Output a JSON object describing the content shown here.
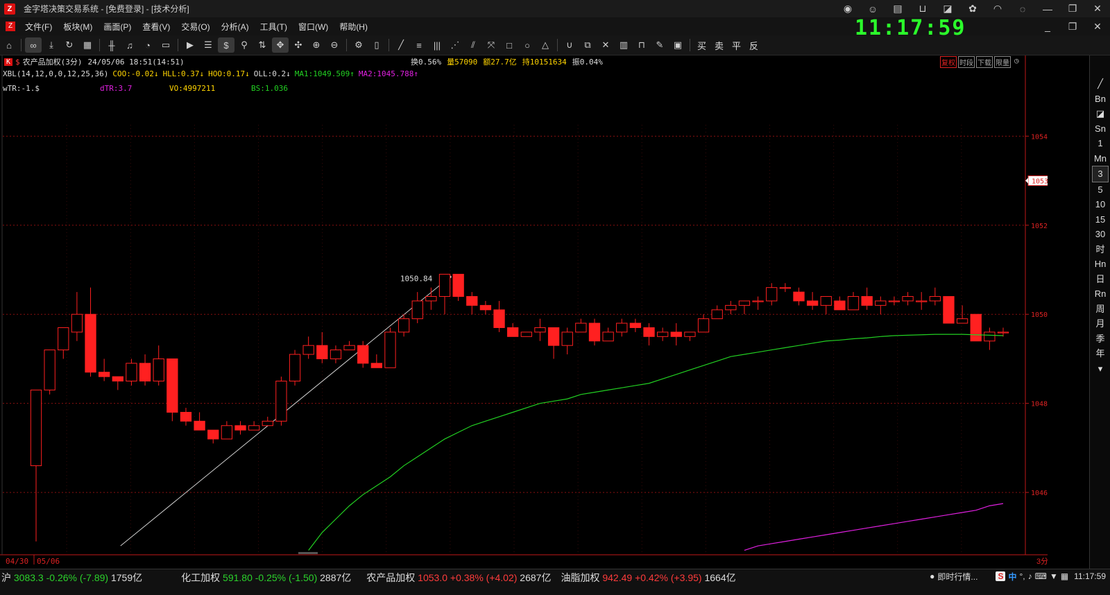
{
  "window": {
    "title": "金字塔决策交易系统 - [免费登录] - [技术分析]"
  },
  "menu": [
    "文件(F)",
    "板块(M)",
    "画面(P)",
    "查看(V)",
    "交易(O)",
    "分析(A)",
    "工具(T)",
    "窗口(W)",
    "帮助(H)"
  ],
  "clock": "11:17:59",
  "toolbar": {
    "right_labels": [
      "买",
      "卖",
      "平",
      "反"
    ],
    "dollar": "$"
  },
  "info": {
    "badge": "K",
    "instrument": "农产品加权(3分)",
    "datetime": "24/05/06 18:51(14:51)",
    "huan": "换0.56%",
    "liang": "量57090",
    "e": "额27.7亿",
    "chi": "持10151634",
    "zhen": "振0.04%",
    "buttons": [
      "复权",
      "时段",
      "下载",
      "限量"
    ]
  },
  "indicator1": {
    "name": "XBL(14,12,0,0,12,25,36)",
    "coo": "COO:-0.02↓",
    "hll": "HLL:0.37↓",
    "hoo": "HOO:0.17↓",
    "oll": "OLL:0.2↓",
    "ma1": "MA1:1049.509↑",
    "ma2": "MA2:1045.788↑"
  },
  "indicator2": {
    "wtr": "wTR:-1.$",
    "dtr": "dTR:3.7",
    "vo": "VO:4997211",
    "bs": "BS:1.036"
  },
  "colors": {
    "up": "#ff2020",
    "ma1": "#22d022",
    "ma2": "#e020e0",
    "grid": "#8a1010",
    "axis": "#c01818",
    "hollow": "#ff2020"
  },
  "periods": [
    "Bn",
    "Sn",
    "1",
    "Mn",
    "3",
    "5",
    "10",
    "15",
    "30",
    "时",
    "Hn",
    "日",
    "Rn",
    "周",
    "月",
    "季",
    "年"
  ],
  "selected_period": "3",
  "chart_data": {
    "type": "candlestick",
    "y_ticks": [
      "1054.00",
      "1052.00",
      "1050.00",
      "1048.00",
      "1046.00"
    ],
    "ylim": [
      1044.6,
      1055.5
    ],
    "current_price": "1053.00",
    "current_value": 1053.0,
    "annotation": "1050.84",
    "x_labels": [
      "04/30",
      "05/06"
    ],
    "period_label": "3分",
    "candles": [
      [
        1046.6,
        1048.3,
        1044.9,
        1048.3
      ],
      [
        1048.3,
        1049.2,
        1048.2,
        1049.2
      ],
      [
        1049.2,
        1049.7,
        1049.0,
        1049.6
      ],
      [
        1049.6,
        1050.0,
        1049.4,
        1050.5
      ],
      [
        1050.0,
        1048.7,
        1048.6,
        1050.6
      ],
      [
        1048.7,
        1048.6,
        1048.5,
        1049.0
      ],
      [
        1048.6,
        1048.5,
        1048.3,
        1048.6
      ],
      [
        1048.5,
        1048.9,
        1048.4,
        1049.0
      ],
      [
        1048.9,
        1048.5,
        1048.4,
        1049.1
      ],
      [
        1048.5,
        1049.0,
        1048.4,
        1049.3
      ],
      [
        1049.0,
        1047.8,
        1047.6,
        1049.0
      ],
      [
        1047.8,
        1047.6,
        1047.5,
        1047.9
      ],
      [
        1047.6,
        1047.4,
        1047.4,
        1047.8
      ],
      [
        1047.4,
        1047.2,
        1047.1,
        1047.4
      ],
      [
        1047.2,
        1047.5,
        1047.2,
        1047.6
      ],
      [
        1047.5,
        1047.4,
        1047.3,
        1047.6
      ],
      [
        1047.4,
        1047.5,
        1047.4,
        1047.6
      ],
      [
        1047.5,
        1047.6,
        1047.5,
        1047.7
      ],
      [
        1047.6,
        1048.5,
        1047.5,
        1048.6
      ],
      [
        1048.5,
        1049.1,
        1048.4,
        1049.2
      ],
      [
        1049.1,
        1049.3,
        1049.0,
        1049.5
      ],
      [
        1049.3,
        1049.0,
        1048.9,
        1049.6
      ],
      [
        1049.0,
        1049.2,
        1048.9,
        1049.3
      ],
      [
        1049.2,
        1049.3,
        1049.2,
        1049.4
      ],
      [
        1049.3,
        1048.9,
        1048.8,
        1049.4
      ],
      [
        1048.9,
        1048.8,
        1048.8,
        1049.1
      ],
      [
        1048.8,
        1049.6,
        1048.8,
        1049.7
      ],
      [
        1049.6,
        1049.9,
        1049.5,
        1050.0
      ],
      [
        1049.9,
        1050.3,
        1049.8,
        1050.5
      ],
      [
        1050.3,
        1050.4,
        1050.1,
        1050.6
      ],
      [
        1050.4,
        1050.9,
        1050.0,
        1050.9
      ],
      [
        1050.9,
        1050.4,
        1050.3,
        1050.9
      ],
      [
        1050.4,
        1050.2,
        1050.0,
        1050.5
      ],
      [
        1050.2,
        1050.1,
        1050.0,
        1050.3
      ],
      [
        1050.1,
        1049.7,
        1049.6,
        1050.3
      ],
      [
        1049.7,
        1049.5,
        1049.5,
        1049.8
      ],
      [
        1049.5,
        1049.6,
        1049.5,
        1049.6
      ],
      [
        1049.6,
        1049.7,
        1049.4,
        1049.9
      ],
      [
        1049.7,
        1049.3,
        1049.0,
        1049.7
      ],
      [
        1049.3,
        1049.6,
        1049.1,
        1049.7
      ],
      [
        1049.6,
        1049.8,
        1049.6,
        1049.9
      ],
      [
        1049.8,
        1049.4,
        1049.3,
        1049.9
      ],
      [
        1049.4,
        1049.6,
        1049.4,
        1049.7
      ],
      [
        1049.6,
        1049.8,
        1049.5,
        1049.9
      ],
      [
        1049.8,
        1049.7,
        1049.6,
        1049.9
      ],
      [
        1049.7,
        1049.5,
        1049.3,
        1049.8
      ],
      [
        1049.5,
        1049.6,
        1049.4,
        1049.7
      ],
      [
        1049.6,
        1049.5,
        1049.3,
        1049.8
      ],
      [
        1049.5,
        1049.6,
        1049.4,
        1049.6
      ],
      [
        1049.6,
        1049.9,
        1049.6,
        1050.0
      ],
      [
        1049.9,
        1050.1,
        1049.9,
        1050.2
      ],
      [
        1050.1,
        1050.2,
        1050.0,
        1050.3
      ],
      [
        1050.2,
        1050.3,
        1050.0,
        1050.3
      ],
      [
        1050.3,
        1050.3,
        1050.1,
        1050.4
      ],
      [
        1050.3,
        1050.6,
        1050.2,
        1050.7
      ],
      [
        1050.6,
        1050.6,
        1050.5,
        1050.7
      ],
      [
        1050.5,
        1050.3,
        1050.2,
        1050.6
      ],
      [
        1050.3,
        1050.2,
        1050.1,
        1050.5
      ],
      [
        1050.2,
        1050.4,
        1050.0,
        1050.4
      ],
      [
        1050.3,
        1050.1,
        1050.1,
        1050.4
      ],
      [
        1050.1,
        1050.4,
        1050.1,
        1050.5
      ],
      [
        1050.4,
        1050.2,
        1050.1,
        1050.6
      ],
      [
        1050.2,
        1050.3,
        1050.0,
        1050.4
      ],
      [
        1050.3,
        1050.3,
        1050.2,
        1050.4
      ],
      [
        1050.3,
        1050.4,
        1050.2,
        1050.5
      ],
      [
        1050.3,
        1050.3,
        1050.1,
        1050.5
      ],
      [
        1050.3,
        1050.4,
        1050.2,
        1050.6
      ],
      [
        1050.4,
        1049.8,
        1049.8,
        1050.4
      ],
      [
        1049.8,
        1049.9,
        1049.8,
        1050.2
      ],
      [
        1050.0,
        1049.4,
        1049.4,
        1050.0
      ],
      [
        1049.4,
        1049.6,
        1049.2,
        1049.7
      ],
      [
        1049.6,
        1049.6,
        1049.5,
        1049.7
      ]
    ],
    "ma1": [
      null,
      null,
      null,
      null,
      null,
      null,
      null,
      null,
      null,
      null,
      null,
      null,
      null,
      null,
      null,
      null,
      null,
      null,
      null,
      null,
      1044.7,
      1045.1,
      1045.4,
      1045.7,
      1045.95,
      1046.15,
      1046.35,
      1046.6,
      1046.8,
      1047.0,
      1047.2,
      1047.35,
      1047.5,
      1047.6,
      1047.7,
      1047.8,
      1047.9,
      1048.0,
      1048.05,
      1048.1,
      1048.2,
      1048.25,
      1048.3,
      1048.35,
      1048.4,
      1048.45,
      1048.55,
      1048.65,
      1048.75,
      1048.85,
      1048.95,
      1049.05,
      1049.1,
      1049.15,
      1049.2,
      1049.25,
      1049.3,
      1049.35,
      1049.4,
      1049.42,
      1049.45,
      1049.47,
      1049.5,
      1049.52,
      1049.53,
      1049.54,
      1049.55,
      1049.55,
      1049.55,
      1049.54,
      1049.53,
      1049.52
    ],
    "ma2": [
      null,
      null,
      null,
      null,
      null,
      null,
      null,
      null,
      null,
      null,
      null,
      null,
      null,
      null,
      null,
      null,
      null,
      null,
      null,
      null,
      null,
      null,
      null,
      null,
      null,
      null,
      null,
      null,
      null,
      null,
      null,
      null,
      null,
      null,
      null,
      null,
      null,
      null,
      null,
      null,
      null,
      null,
      null,
      null,
      null,
      null,
      null,
      null,
      null,
      null,
      null,
      null,
      1044.7,
      1044.8,
      1044.85,
      1044.9,
      1044.95,
      1045.0,
      1045.05,
      1045.1,
      1045.15,
      1045.2,
      1045.25,
      1045.3,
      1045.35,
      1045.4,
      1045.45,
      1045.5,
      1045.55,
      1045.6,
      1045.7,
      1045.75
    ]
  },
  "status": [
    {
      "name": "沪",
      "value": "3083.3",
      "pct": "-0.26%",
      "chg": "(-7.89)",
      "amt": "1759亿",
      "dir": "down"
    },
    {
      "name": "化工加权",
      "value": "591.80",
      "pct": "-0.25%",
      "chg": "(-1.50)",
      "amt": "2887亿",
      "dir": "down"
    },
    {
      "name": "农产品加权",
      "value": "1053.0",
      "pct": "+0.38%",
      "chg": "(+4.02)",
      "amt": "2687亿",
      "dir": "up"
    },
    {
      "name": "油脂加权",
      "value": "942.49",
      "pct": "+0.42%",
      "chg": "(+3.95)",
      "amt": "1664亿",
      "dir": "up"
    }
  ],
  "tray": {
    "news": "即时行情...",
    "ime": "中",
    "time": "11:17:59"
  }
}
